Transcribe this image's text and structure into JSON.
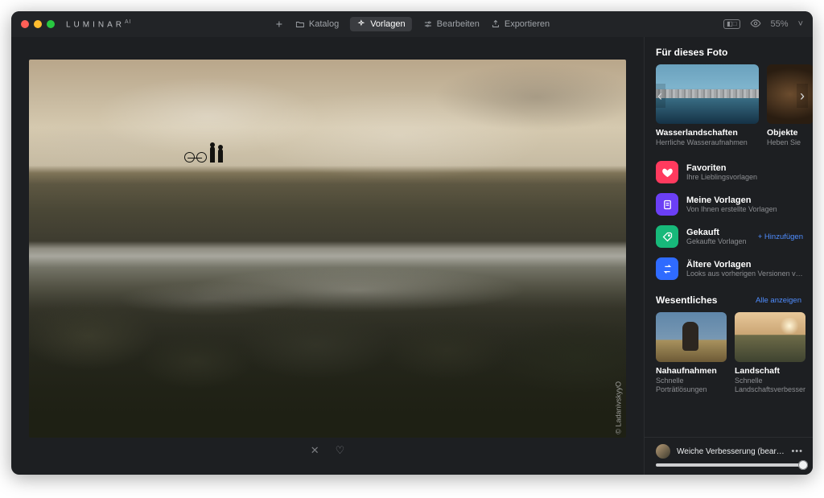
{
  "brand": {
    "name": "LUMINAR",
    "suffix": "AI"
  },
  "nav": {
    "add_label": "",
    "catalog": "Katalog",
    "templates": "Vorlagen",
    "edit": "Bearbeiten",
    "export": "Exportieren"
  },
  "top_right": {
    "zoom": "55%",
    "chevron": "˅"
  },
  "canvas": {
    "credit": "© LadanivskyyO"
  },
  "footer": {
    "reject": "✕",
    "like": "♡"
  },
  "side": {
    "section1_title": "Für dieses Foto",
    "carousel": [
      {
        "title": "Wasserlandschaften",
        "sub": "Herrliche Wasseraufnahmen"
      },
      {
        "title": "Objekte",
        "sub": "Heben Sie"
      }
    ],
    "categories": [
      {
        "name": "Favoriten",
        "desc": "Ihre Lieblingsvorlagen",
        "color": "pink",
        "icon": "heart"
      },
      {
        "name": "Meine Vorlagen",
        "desc": "Von Ihnen erstellte Vorlagen",
        "color": "purple",
        "icon": "doc"
      },
      {
        "name": "Gekauft",
        "desc": "Gekaufte Vorlagen",
        "color": "green",
        "icon": "tag",
        "action": "+ Hinzufügen"
      },
      {
        "name": "Ältere Vorlagen",
        "desc": "Looks aus vorherigen Versionen von Luminar",
        "color": "blue",
        "icon": "swap"
      }
    ],
    "section2_title": "Wesentliches",
    "section2_link": "Alle anzeigen",
    "essentials": [
      {
        "title": "Nahaufnahmen",
        "sub": "Schnelle Porträtlösungen"
      },
      {
        "title": "Landschaft",
        "sub": "Schnelle Landschaftsverbesserungen"
      }
    ]
  },
  "slider": {
    "label": "Weiche Verbesserung (bearbeite",
    "more": "•••"
  }
}
